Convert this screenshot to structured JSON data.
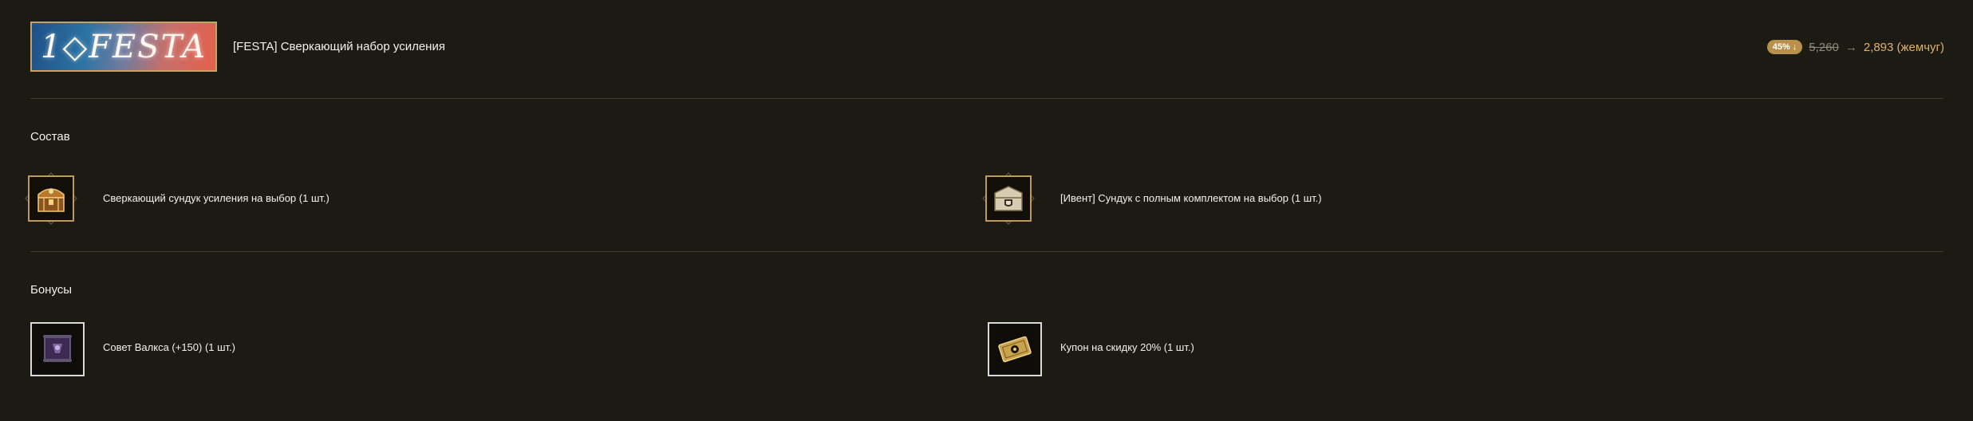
{
  "header": {
    "banner_text": "1◇FESTA",
    "title": "[FESTA] Сверкающий набор усиления",
    "discount_badge": "45% ↓",
    "old_price": "5,260",
    "arrow": "→",
    "new_price": "2,893 (жемчуг)"
  },
  "contents": {
    "heading": "Состав",
    "items": [
      {
        "label": "Сверкающий сундук усиления на выбор (1 шт.)",
        "icon": "golden-chest-icon"
      },
      {
        "label": "[Ивент] Сундук с полным комплектом на выбор (1 шт.)",
        "icon": "shield-chest-icon"
      }
    ]
  },
  "bonuses": {
    "heading": "Бонусы",
    "items": [
      {
        "label": "Совет Валкса (+150) (1 шт.)",
        "icon": "valks-scroll-icon"
      },
      {
        "label": "Купон на скидку 20% (1 шт.)",
        "icon": "coupon-icon"
      }
    ]
  },
  "colors": {
    "background": "#1b1a13",
    "divider": "#3f3d32",
    "accent_gold": "#e0b266",
    "badge": "#b8904a"
  }
}
